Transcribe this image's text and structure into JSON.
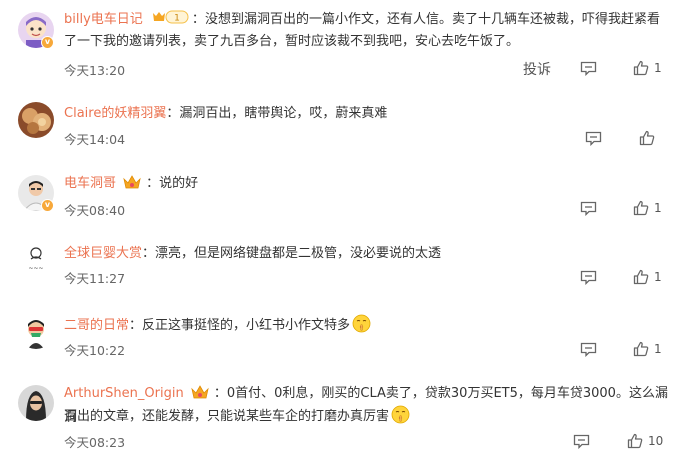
{
  "comments": [
    {
      "username": "billy电车日记",
      "badge": "vip-level-badge",
      "badge_level": "1",
      "text_line1": "没想到漏洞百出的一篇小作文，还有人信。卖了十几辆车还被裁，吓得我赶紧看",
      "text_line2": "了一下我的邀请列表，卖了九百多台，暂时应该裁不到我吧，安心去吃午饭了。",
      "time": "今天13:20",
      "report_label": "投诉",
      "likes": "1",
      "avatar_icon": "cartoon-avatar-icon",
      "verified_badge": "v"
    },
    {
      "username": "Claire的妖精羽翼",
      "text_line1": "漏洞百出，瞎带舆论，哎，蔚来真难",
      "time": "今天14:04",
      "likes": "",
      "avatar_icon": "food-photo-avatar-icon"
    },
    {
      "username": "电车洞哥",
      "badge": "crown-icon",
      "text_line1": "说的好",
      "time": "今天08:40",
      "likes": "1",
      "avatar_icon": "person-avatar-icon",
      "verified_badge": "v"
    },
    {
      "username": "全球巨婴大赏",
      "text_line1": "漂亮，但是网络键盘都是二极管，没必要说的太透",
      "time": "今天11:27",
      "likes": "1",
      "avatar_icon": "doodle-avatar-icon"
    },
    {
      "username": "二哥的日常",
      "text_line1": "反正这事挺怪的，小红书小作文特多",
      "time": "今天10:22",
      "likes": "1",
      "avatar_icon": "mask-avatar-icon",
      "emoji": "shush-emoji-icon"
    },
    {
      "username": "ArthurShen_Origin",
      "badge": "crown-icon",
      "text_line1": "0首付、0利息，刚买的CLA卖了，贷款30万买ET5，每月车贷3000。这么漏洞",
      "text_line2": "百出的文章，还能发酵，只能说某些车企的打磨办真厉害",
      "time": "今天08:23",
      "likes": "10",
      "avatar_icon": "woman-avatar-icon",
      "emoji": "shush-emoji-icon"
    }
  ],
  "colors": {
    "username": "#eb7350",
    "text": "#333333",
    "meta": "#666666",
    "badge": "#f7a83a"
  }
}
